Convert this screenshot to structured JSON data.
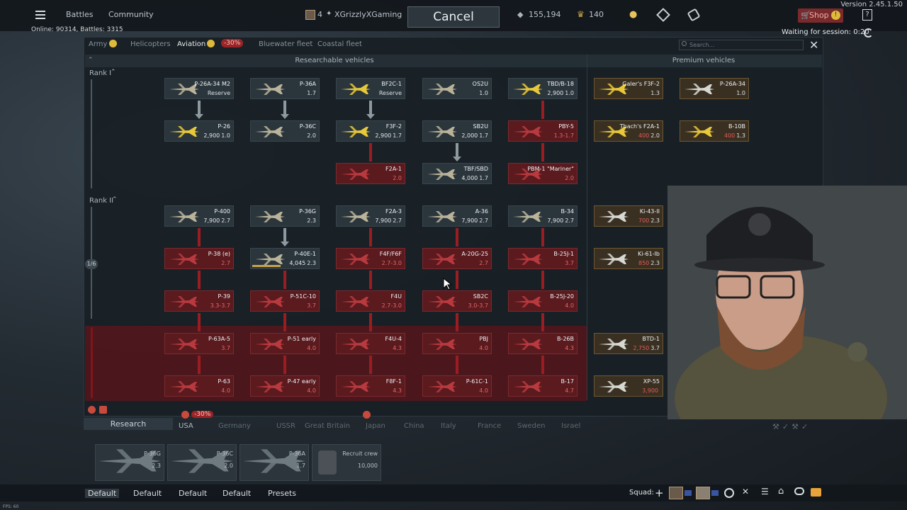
{
  "window": {
    "version": "Version 2.45.1.50"
  },
  "topbar": {
    "menu_icon": "hamburger-icon",
    "battles": "Battles",
    "community": "Community",
    "player_level": "4",
    "player_name": "XGrizzlyXGaming",
    "cancel": "Cancel",
    "silver_lions": "155,194",
    "golden_eagles": "140",
    "shop": "Shop",
    "waiting": "Waiting for session: 0:20"
  },
  "status": {
    "online": "Online: 90314, Battles: 3315"
  },
  "tabs": [
    {
      "label": "Army",
      "active": false
    },
    {
      "label": "Helicopters",
      "active": false
    },
    {
      "label": "Aviation",
      "active": true,
      "discount": "-30%"
    },
    {
      "label": "Bluewater fleet",
      "active": false
    },
    {
      "label": "Coastal fleet",
      "active": false
    }
  ],
  "search": {
    "placeholder": "Search..."
  },
  "headers": {
    "researchable": "Researchable vehicles",
    "premium": "Premium vehicles"
  },
  "ranks": {
    "rank1": "Rank I",
    "rank2": "Rank II",
    "progress": "1/6"
  },
  "vehicles": [
    {
      "name": "P-26A-34 M2",
      "cost": "",
      "br": "Reserve",
      "state": "researched"
    },
    {
      "name": "P-36A",
      "cost": "",
      "br": "1.7",
      "state": "researched"
    },
    {
      "name": "BF2C-1",
      "cost": "",
      "br": "Reserve",
      "state": "researched"
    },
    {
      "name": "OS2U",
      "cost": "",
      "br": "1.0",
      "state": "researched"
    },
    {
      "name": "TBD/B-18",
      "cost": "2,900",
      "br": "1.0",
      "state": "researched"
    },
    {
      "name": "P-26",
      "cost": "2,900",
      "br": "1.0",
      "state": "researched"
    },
    {
      "name": "P-36C",
      "cost": "",
      "br": "2.0",
      "state": "researched"
    },
    {
      "name": "F3F-2",
      "cost": "2,900",
      "br": "1.7",
      "state": "researched"
    },
    {
      "name": "SB2U",
      "cost": "2,000",
      "br": "1.7",
      "state": "researched"
    },
    {
      "name": "PBY-5",
      "cost": "",
      "br": "1.3-1.7",
      "state": "locked"
    },
    {
      "name": "F2A-1",
      "cost": "",
      "br": "2.0",
      "state": "locked"
    },
    {
      "name": "TBF/SBD",
      "cost": "4,000",
      "br": "1.7",
      "state": "researched"
    },
    {
      "name": "PBM-1 \"Mariner\"",
      "cost": "",
      "br": "2.0",
      "state": "locked"
    },
    {
      "name": "P-400",
      "cost": "7,900",
      "br": "2.7",
      "state": "researched"
    },
    {
      "name": "P-36G",
      "cost": "",
      "br": "2.3",
      "state": "researched"
    },
    {
      "name": "F2A-3",
      "cost": "7,900",
      "br": "2.7",
      "state": "researched"
    },
    {
      "name": "A-36",
      "cost": "7,900",
      "br": "2.7",
      "state": "researched"
    },
    {
      "name": "B-34",
      "cost": "7,900",
      "br": "2.7",
      "state": "researched"
    },
    {
      "name": "P-38 (e)",
      "cost": "",
      "br": "2.7",
      "state": "locked"
    },
    {
      "name": "P-40E-1",
      "cost": "4,045",
      "br": "2.3",
      "state": "researching"
    },
    {
      "name": "F4F/F6F",
      "cost": "",
      "br": "2.7-3.0",
      "state": "locked"
    },
    {
      "name": "A-20G-25",
      "cost": "",
      "br": "2.7",
      "state": "locked"
    },
    {
      "name": "B-25J-1",
      "cost": "",
      "br": "3.7",
      "state": "locked"
    },
    {
      "name": "P-39",
      "cost": "",
      "br": "3.3-3.7",
      "state": "locked"
    },
    {
      "name": "P-51C-10",
      "cost": "",
      "br": "3.7",
      "state": "locked"
    },
    {
      "name": "F4U",
      "cost": "",
      "br": "2.7-3.0",
      "state": "locked"
    },
    {
      "name": "SB2C",
      "cost": "",
      "br": "3.0-3.7",
      "state": "locked"
    },
    {
      "name": "B-25J-20",
      "cost": "",
      "br": "4.0",
      "state": "locked"
    },
    {
      "name": "P-63A-5",
      "cost": "",
      "br": "3.7",
      "state": "locked"
    },
    {
      "name": "P-51 early",
      "cost": "",
      "br": "4.0",
      "state": "locked"
    },
    {
      "name": "F4U-4",
      "cost": "",
      "br": "4.3",
      "state": "locked"
    },
    {
      "name": "PBJ",
      "cost": "",
      "br": "4.0",
      "state": "locked"
    },
    {
      "name": "B-26B",
      "cost": "",
      "br": "4.3",
      "state": "locked"
    },
    {
      "name": "P-63",
      "cost": "",
      "br": "4.0",
      "state": "locked"
    },
    {
      "name": "P-47 early",
      "cost": "",
      "br": "4.0",
      "state": "locked"
    },
    {
      "name": "F8F-1",
      "cost": "",
      "br": "4.3",
      "state": "locked"
    },
    {
      "name": "P-61C-1",
      "cost": "",
      "br": "4.0",
      "state": "locked"
    },
    {
      "name": "B-17",
      "cost": "",
      "br": "4.7",
      "state": "locked"
    }
  ],
  "premium": [
    {
      "name": "Galer's F3F-2",
      "cost": "",
      "br": "1.3"
    },
    {
      "name": "P-26A-34",
      "cost": "",
      "br": "1.0"
    },
    {
      "name": "Thach's F2A-1",
      "cost": "400",
      "br": "2.0"
    },
    {
      "name": "B-10B",
      "cost": "400",
      "br": "1.3"
    },
    {
      "name": "Ki-43-II",
      "cost": "700",
      "br": "2.3"
    },
    {
      "name": "Ki-61-Ib",
      "cost": "850",
      "br": "2.3"
    },
    {
      "name": "BTD-1",
      "cost": "2,750",
      "br": "3.7"
    },
    {
      "name": "XP-55",
      "cost": "3,900",
      "br": ""
    }
  ],
  "bottom": {
    "research": "Research",
    "discount": "-30%",
    "nations": [
      "USA",
      "Germany",
      "USSR",
      "Great Britain",
      "Japan",
      "China",
      "Italy",
      "France",
      "Sweden",
      "Israel"
    ],
    "crew": [
      {
        "name": "P-36G",
        "br": "2.3"
      },
      {
        "name": "P-36C",
        "br": "2.0"
      },
      {
        "name": "P-36A",
        "br": "1.7"
      },
      {
        "name": "Recruit crew",
        "br": "10,000"
      }
    ],
    "presets": [
      "Default",
      "Default",
      "Default",
      "Default",
      "Presets"
    ],
    "squad": "Squad:",
    "fps": "FPS: 60"
  },
  "colors": {
    "locked_red": "#5a1a1e",
    "accent_red": "#9d2426",
    "gold": "#c8a24a"
  }
}
